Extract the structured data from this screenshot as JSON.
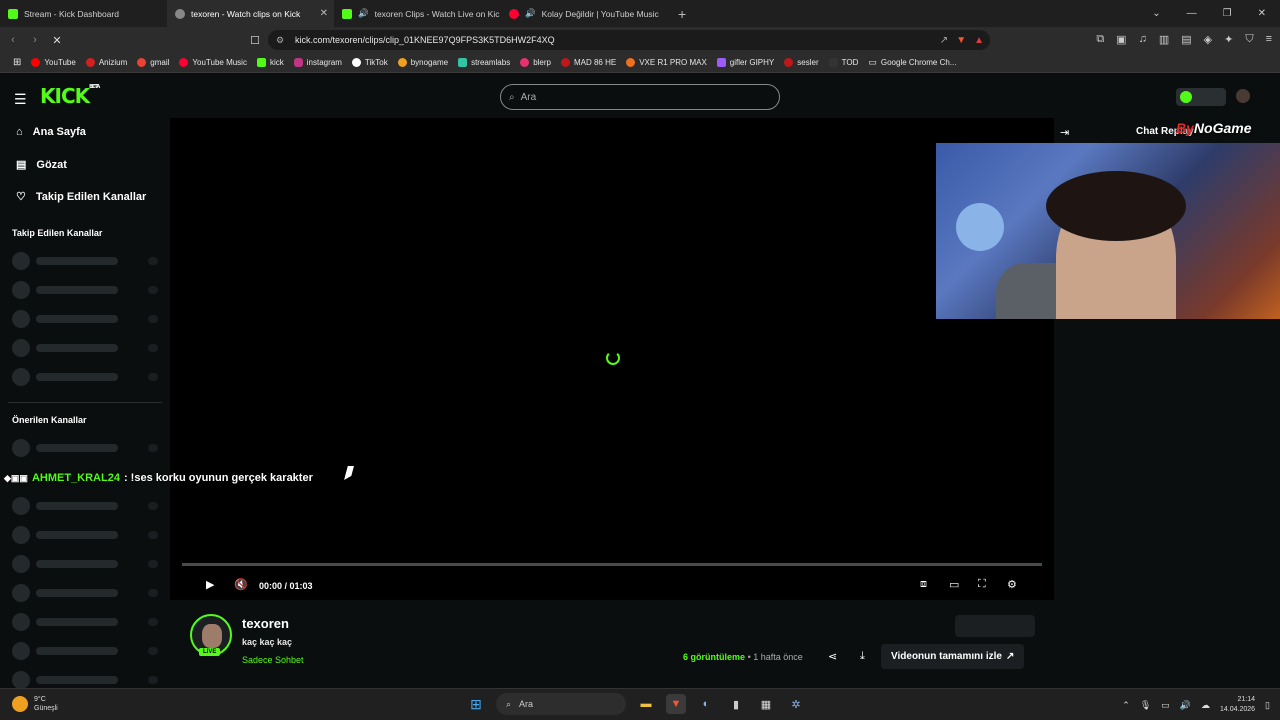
{
  "tabs": [
    {
      "title": "Stream - Kick Dashboard",
      "color": "#53fc18"
    },
    {
      "title": "texoren - Watch clips on Kick",
      "color": "#888888",
      "active": true
    },
    {
      "title": "texoren Clips - Watch Live on Kic",
      "color": "#53fc18"
    },
    {
      "title": "Kolay Değildir | YouTube Music",
      "color": "#ff0033"
    }
  ],
  "address": {
    "url": "kick.com/texoren/clips/clip_01KNEE97Q9FPS3K5TD6HW2F4XQ"
  },
  "bookmarks": [
    {
      "label": "YouTube",
      "color": "#ff0000"
    },
    {
      "label": "Anizium",
      "color": "#d62020"
    },
    {
      "label": "gmail",
      "color": "#ea4335"
    },
    {
      "label": "YouTube Music",
      "color": "#ff0033"
    },
    {
      "label": "kick",
      "color": "#53fc18"
    },
    {
      "label": "instagram",
      "color": "#c13584"
    },
    {
      "label": "TikTok",
      "color": "#ffffff"
    },
    {
      "label": "bynogame",
      "color": "#f0a020"
    },
    {
      "label": "streamlabs",
      "color": "#31c3a2"
    },
    {
      "label": "blerp",
      "color": "#e8316e"
    },
    {
      "label": "MAD 86 HE",
      "color": "#c01818"
    },
    {
      "label": "VXE R1 PRO MAX",
      "color": "#f07020"
    },
    {
      "label": "gifler GIPHY",
      "color": "#9c5cf5"
    },
    {
      "label": "sesler",
      "color": "#c01818"
    },
    {
      "label": "TOD",
      "color": "#333333"
    },
    {
      "label": "Google Chrome Ch...",
      "color": "#888888"
    }
  ],
  "search": {
    "placeholder": "Ara"
  },
  "sidebar": {
    "nav": [
      {
        "label": "Ana Sayfa",
        "icon": "home-icon"
      },
      {
        "label": "Gözat",
        "icon": "browse-icon"
      },
      {
        "label": "Takip Edilen Kanallar",
        "icon": "heart-icon"
      }
    ],
    "followed_heading": "Takip Edilen Kanallar",
    "recommended_heading": "Önerilen Kanallar"
  },
  "player": {
    "time": "00:00 / 01:03",
    "overlay_user": "AHMET_KRAL24",
    "overlay_message": ": !ses korku oyunun gerçek karakter"
  },
  "chat": {
    "title": "Chat Replay",
    "watermark_left": "By",
    "watermark_right": "NoGame"
  },
  "channel": {
    "name": "texoren",
    "title": "kaç kaç kaç",
    "category": "Sadece Sohbet",
    "live_badge": "LIVE",
    "views_count": "6",
    "views_label": "görüntüleme",
    "ago": "• 1 hafta önce",
    "watch_full": "Videonun tamamını izle"
  },
  "taskbar": {
    "temp": "9°C",
    "weather": "Güneşli",
    "search": "Ara",
    "time": "21:14",
    "date": "14.04.2026"
  }
}
